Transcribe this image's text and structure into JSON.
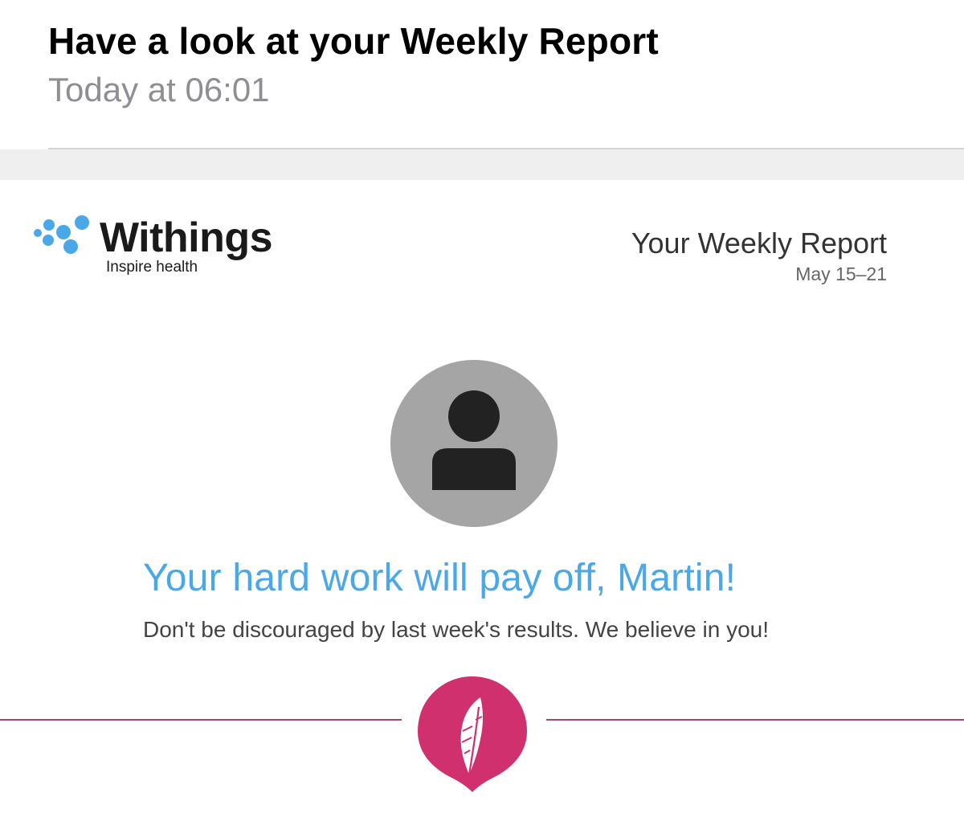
{
  "mail": {
    "subject": "Have a look at your Weekly Report",
    "received": "Today at 06:01"
  },
  "report": {
    "brand": {
      "name": "Withings",
      "tagline": "Inspire health",
      "color": "#4aa8e8"
    },
    "title": "Your Weekly Report",
    "dates": "May 15–21",
    "avatar_icon": "user-silhouette-icon",
    "headline": "Your hard work will pay off, Martin!",
    "message": "Don't be discouraged by last week's results. We believe in you!",
    "section_icon": "feather-icon",
    "accent_color": "#d1306f"
  }
}
